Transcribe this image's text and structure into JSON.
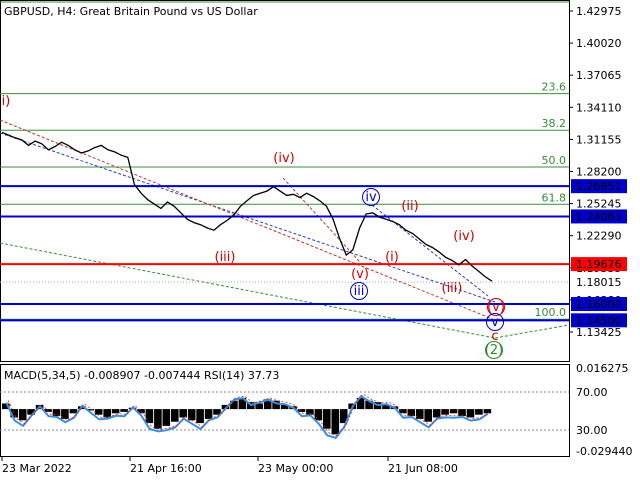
{
  "chart_data": {
    "type": "candlestick",
    "title": "GBPUSD, H4:  Great Britain Pound vs US Dollar",
    "price_ticks": [
      "1.42975",
      "1.40020",
      "1.37065",
      "1.34110",
      "1.31155",
      "1.28200",
      "1.25245",
      "1.22290",
      "1.19335",
      "1.16380",
      "1.13425"
    ],
    "price_tick_values": [
      1.42975,
      1.4002,
      1.37065,
      1.3411,
      1.31155,
      1.282,
      1.25245,
      1.2229,
      1.19335,
      1.1638,
      1.13425
    ],
    "x_ticks": [
      "23 Mar 2022",
      "21 Apr 16:00",
      "23 May 00:00",
      "21 Jun 08:00"
    ],
    "horizontal_levels": [
      {
        "label": "1.26851",
        "value": 1.26851,
        "color": "#0000cd"
      },
      {
        "label": "1.24063",
        "value": 1.24063,
        "color": "#0000cd"
      },
      {
        "label": "1.19676",
        "value": 1.19676,
        "color": "#ff0000"
      },
      {
        "label": "1.16000",
        "value": 1.16,
        "color": "#0000cd"
      },
      {
        "label": "1.14500",
        "value": 1.145,
        "color": "#0000cd"
      }
    ],
    "current_price": {
      "label": "1.18015",
      "value": 1.18015
    },
    "fibonacci_levels": [
      {
        "label": "0.0",
        "value": 1.438
      },
      {
        "label": "23.6",
        "value": 1.3537
      },
      {
        "label": "38.2",
        "value": 1.32
      },
      {
        "label": "50.0",
        "value": 1.2862
      },
      {
        "label": "61.8",
        "value": 1.2518
      },
      {
        "label": "100.0",
        "value": 1.146
      }
    ],
    "wave_labels": [
      {
        "text": "i)",
        "color": "#d10000",
        "circled": false
      },
      {
        "text": "(iv)",
        "color": "#d10000",
        "circled": false
      },
      {
        "text": "(iii)",
        "color": "#d10000",
        "circled": false
      },
      {
        "text": "iv",
        "color": "#0000cd",
        "circled": true
      },
      {
        "text": "(ii)",
        "color": "#d10000",
        "circled": false
      },
      {
        "text": "(v)",
        "color": "#d10000",
        "circled": false
      },
      {
        "text": "(i)",
        "color": "#d10000",
        "circled": false
      },
      {
        "text": "(iv)",
        "color": "#d10000",
        "circled": false
      },
      {
        "text": "iii",
        "color": "#0000cd",
        "circled": true
      },
      {
        "text": "(iii)",
        "color": "#d10000",
        "circled": false
      },
      {
        "text": "(v)",
        "color": "#d10000",
        "circled": true
      },
      {
        "text": "v",
        "color": "#0000cd",
        "circled": true
      },
      {
        "text": "c",
        "color": "#d10000",
        "circled": false
      },
      {
        "text": "(2)",
        "color": "#2e8b2e",
        "circled": true
      }
    ],
    "price_series": [
      1.318,
      1.3155,
      1.313,
      1.311,
      1.306,
      1.31,
      1.3075,
      1.302,
      1.305,
      1.309,
      1.306,
      1.302,
      1.299,
      1.301,
      1.304,
      1.306,
      1.302,
      1.3,
      1.297,
      1.295,
      1.27,
      1.262,
      1.256,
      1.252,
      1.248,
      1.254,
      1.25,
      1.244,
      1.238,
      1.235,
      1.233,
      1.23,
      1.228,
      1.233,
      1.237,
      1.242,
      1.25,
      1.255,
      1.26,
      1.262,
      1.264,
      1.268,
      1.264,
      1.26,
      1.261,
      1.258,
      1.262,
      1.259,
      1.255,
      1.25,
      1.238,
      1.22,
      1.205,
      1.21,
      1.23,
      1.243,
      1.244,
      1.24,
      1.238,
      1.236,
      1.233,
      1.228,
      1.225,
      1.22,
      1.215,
      1.212,
      1.208,
      1.203,
      1.2,
      1.196,
      1.201,
      1.195,
      1.19,
      1.185,
      1.181
    ],
    "indicator": {
      "label": "MACD(5,34,5) -0.008907 -0.007444 RSI(14) 37.73",
      "y_ticks": [
        "0.016275",
        "-0.029440"
      ],
      "rsi_levels": [
        "70.00",
        "30.00"
      ]
    }
  }
}
